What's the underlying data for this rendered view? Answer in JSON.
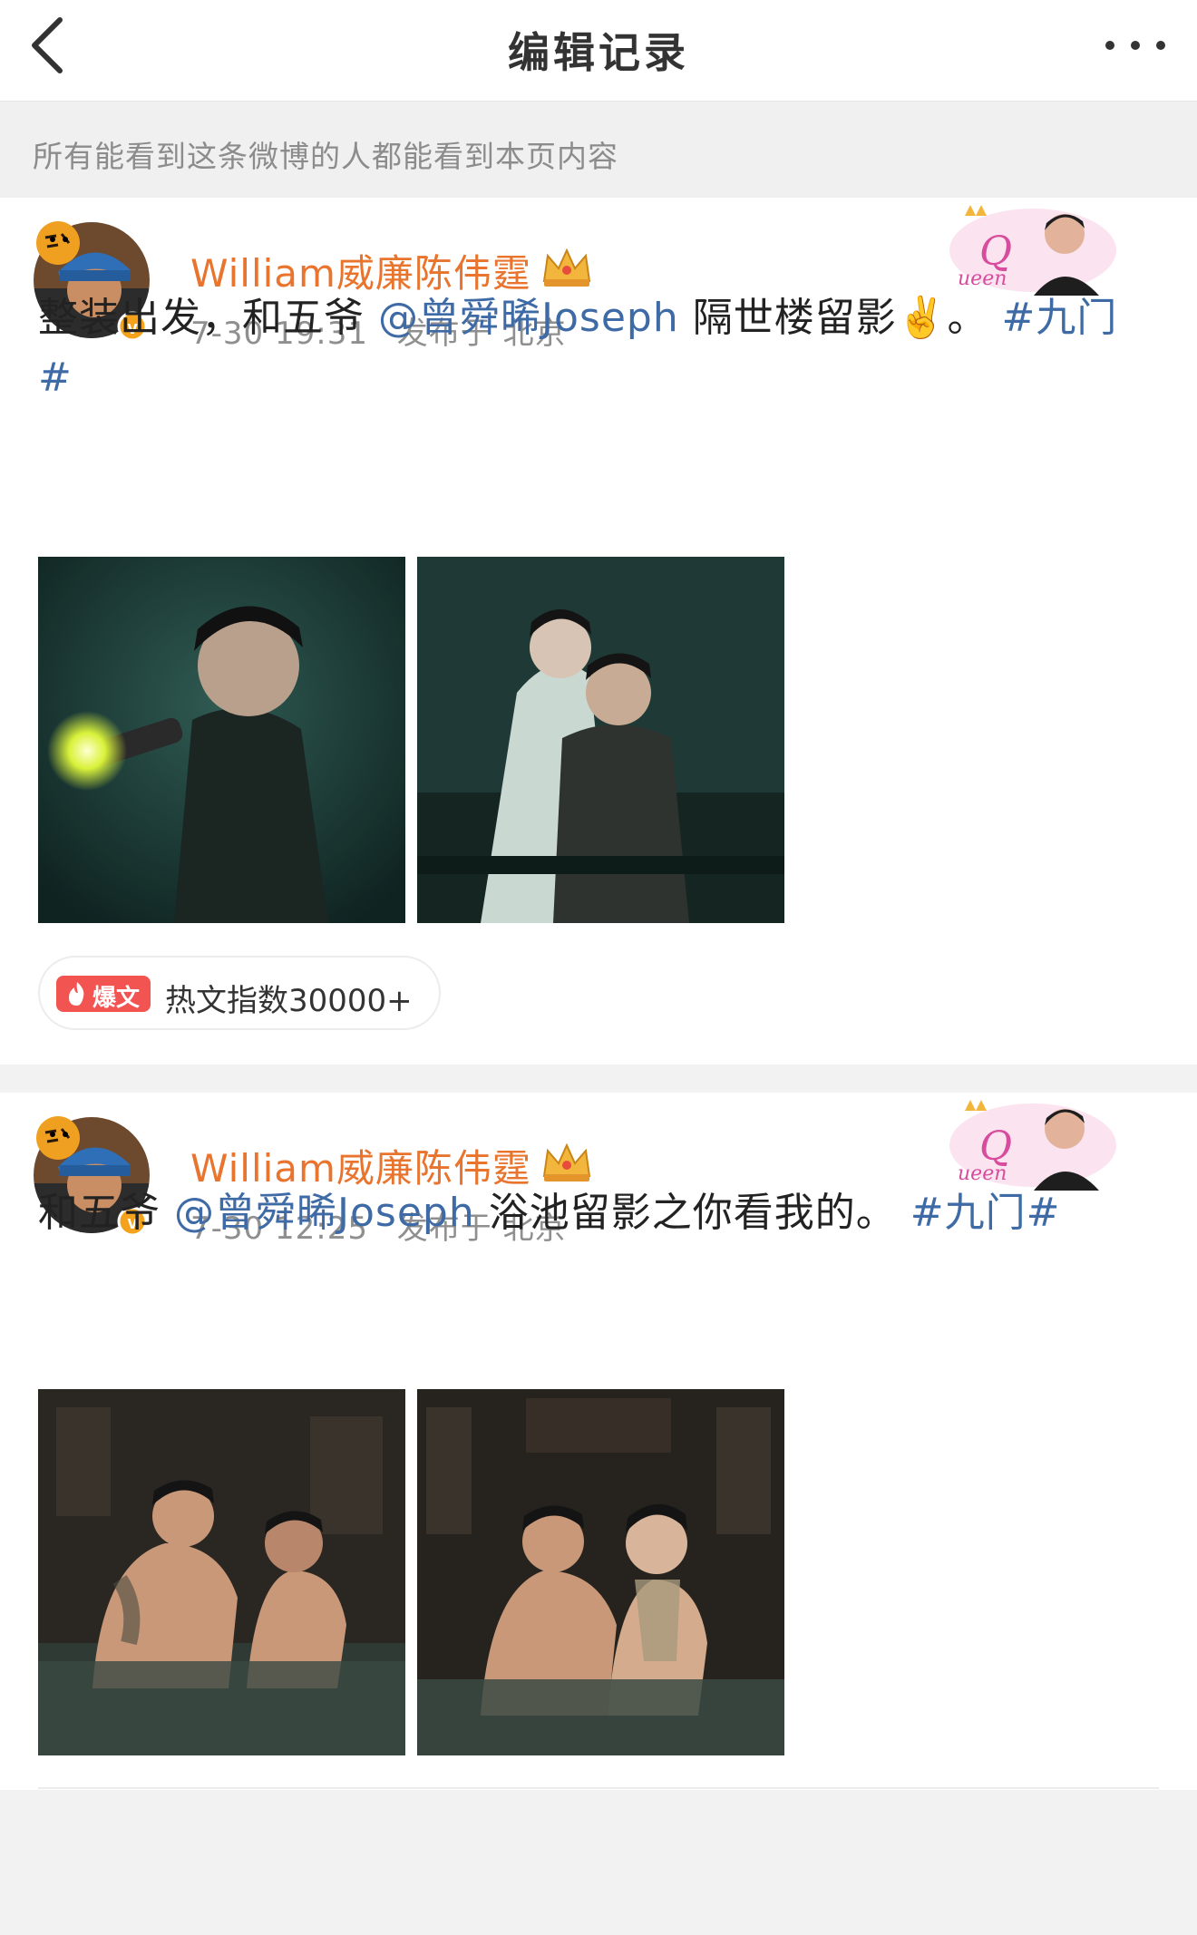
{
  "header": {
    "title": "编辑记录"
  },
  "notice": {
    "text": "所有能看到这条微博的人都能看到本页内容"
  },
  "posts": [
    {
      "author": "William威廉陈伟霆",
      "time": "7-30 19:31",
      "location": "发布于 北京",
      "text_before": "整装出发，和五爷",
      "mention": "@曾舜晞Joseph",
      "text_after": "隔世楼留影✌️。",
      "topic": "#九门#",
      "hot": {
        "badge": "爆文",
        "label": "热文指数30000+"
      },
      "image_count": 2
    },
    {
      "author": "William威廉陈伟霆",
      "time": "7-30 12:25",
      "location": "发布于 北京",
      "text_before": "和五爷",
      "mention": "@曾舜晞Joseph",
      "text_after": "浴池留影之你看我的。",
      "topic": "#九门#",
      "image_count": 2
    }
  ],
  "colors": {
    "author": "#e8742e",
    "link": "#3e6aa6",
    "hot_badge": "#f25452",
    "notice_bg": "#f0f0f0"
  }
}
